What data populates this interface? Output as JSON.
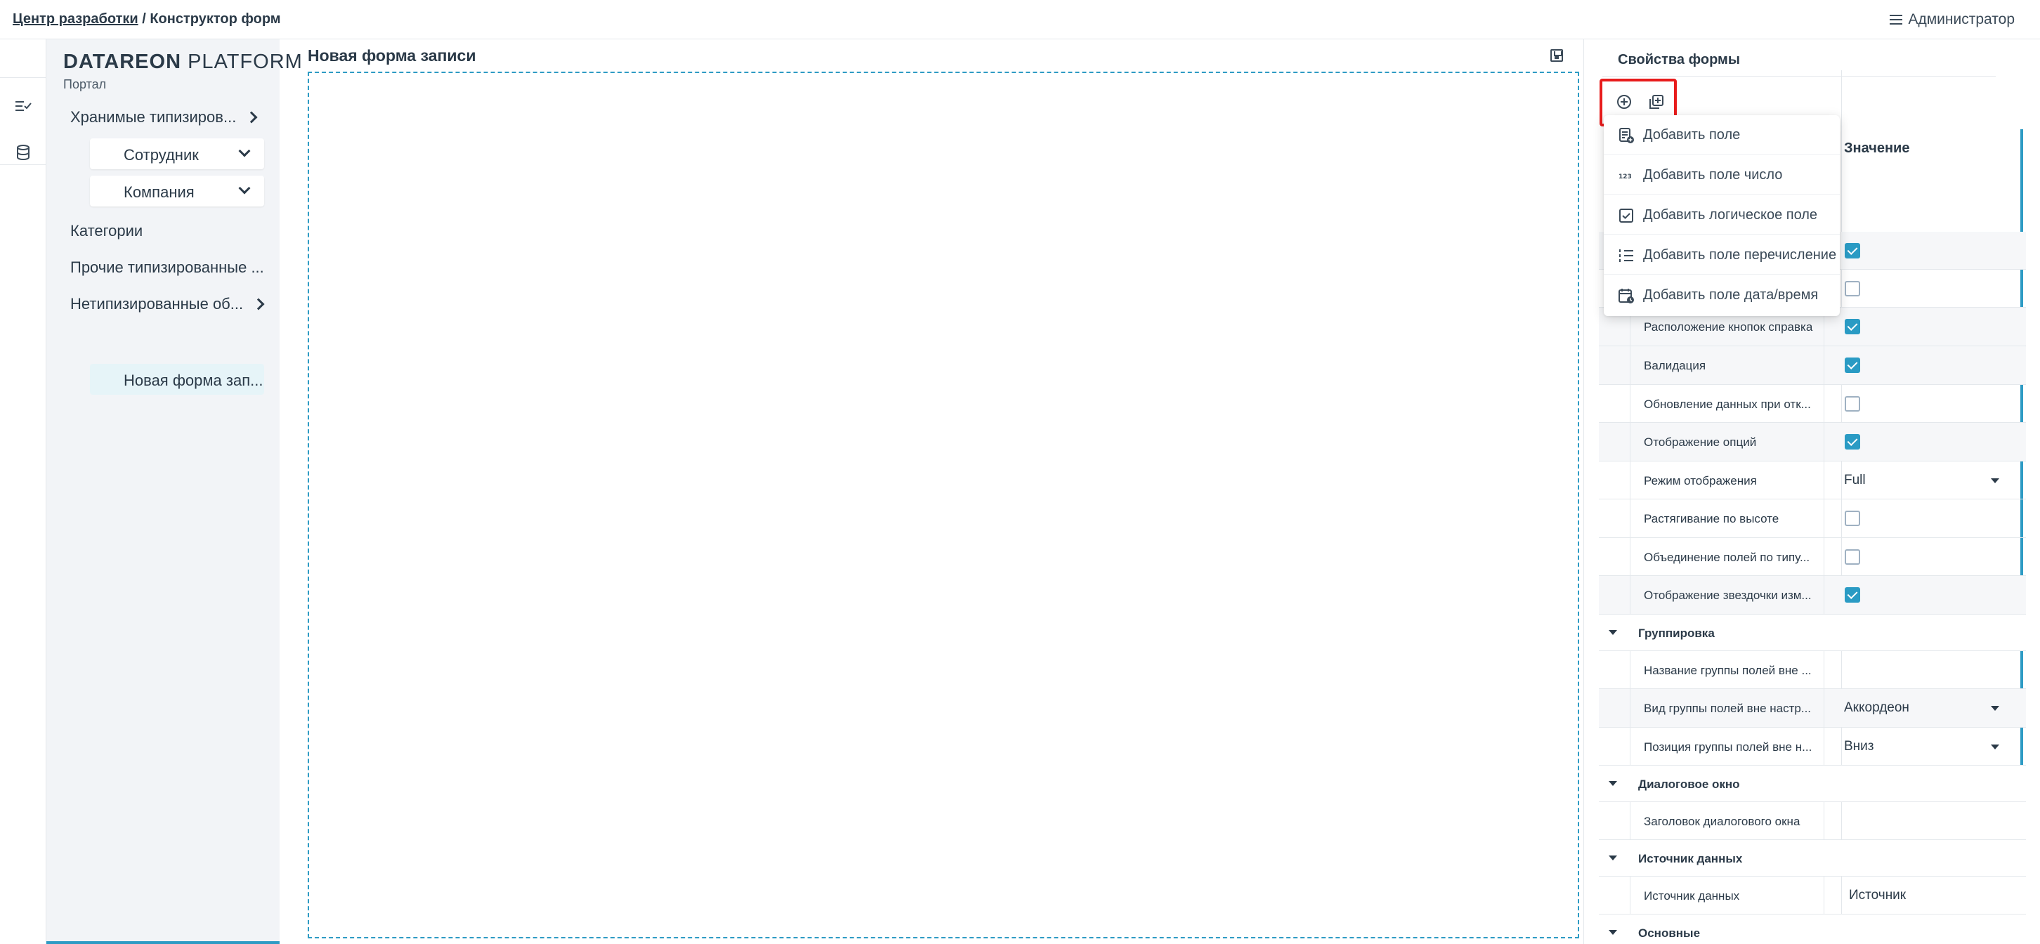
{
  "breadcrumb": {
    "root": "Центр разработки",
    "separator": " / ",
    "current": "Конструктор форм"
  },
  "user": {
    "name": "Администратор"
  },
  "sidebar": {
    "logo_bold": "DATAREON",
    "logo_light": "PLATFORM",
    "portal": "Портал",
    "items": [
      {
        "label": "Хранимые типизиров..."
      },
      {
        "label": "Сотрудник"
      },
      {
        "label": "Компания"
      },
      {
        "label": "Категории"
      },
      {
        "label": "Прочие типизированные ..."
      },
      {
        "label": "Нетипизированные об..."
      },
      {
        "label": "Новая форма зап..."
      }
    ]
  },
  "form": {
    "title": "Новая форма записи"
  },
  "props": {
    "title": "Свойства формы",
    "value_header": "Значение",
    "menu": [
      {
        "label": "Добавить поле",
        "icon": "form-add-icon"
      },
      {
        "label": "Добавить поле число",
        "icon": "number-123-icon"
      },
      {
        "label": "Добавить логическое поле",
        "icon": "checkbox-icon"
      },
      {
        "label": "Добавить поле перечисление",
        "icon": "list-icon"
      },
      {
        "label": "Добавить поле дата/время",
        "icon": "calendar-icon"
      }
    ],
    "rows": [
      {
        "label": "Расположение кнопок справка",
        "checked": true
      },
      {
        "label": "Валидация",
        "checked": true
      },
      {
        "label": "Обновление данных при отк...",
        "checked": false
      },
      {
        "label": "Отображение опций",
        "checked": true
      },
      {
        "label": "Режим отображения",
        "value": "Full"
      },
      {
        "label": "Растягивание по высоте",
        "checked": false
      },
      {
        "label": "Объединение полей по типу...",
        "checked": false
      },
      {
        "label": "Отображение звездочки изм...",
        "checked": true
      }
    ],
    "groups": {
      "grouping": "Группировка",
      "dialog": "Диалоговое окно",
      "source": "Источник данных",
      "main": "Основные"
    },
    "grouping_rows": [
      {
        "label": "Название группы полей вне ...",
        "value": ""
      },
      {
        "label": "Вид группы полей вне настр...",
        "value": "Аккордеон"
      },
      {
        "label": "Позиция группы полей вне н...",
        "value": "Вниз"
      }
    ],
    "dialog_rows": [
      {
        "label": "Заголовок диалогового окна",
        "value": ""
      }
    ],
    "source_rows": [
      {
        "label": "Источник данных",
        "value": "Источник"
      }
    ],
    "partial_checks": [
      true,
      false
    ]
  }
}
